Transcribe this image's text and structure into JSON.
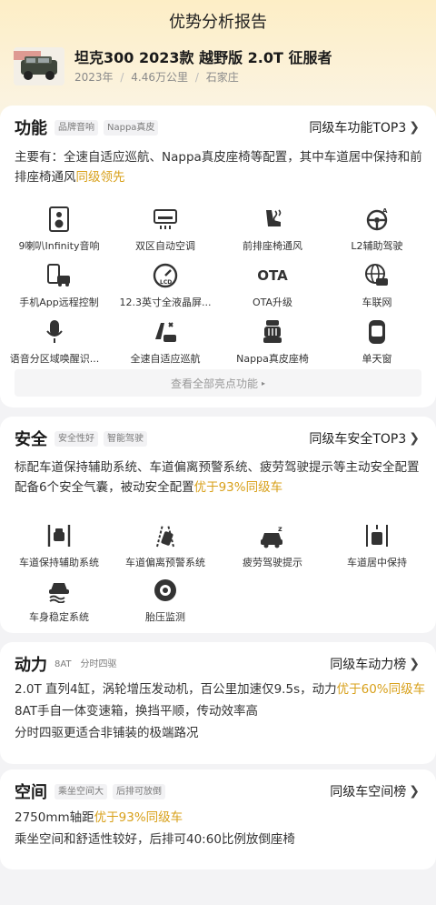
{
  "page_title": "优势分析报告",
  "car": {
    "name": "坦克300 2023款 越野版 2.0T 征服者",
    "year": "2023年",
    "mileage": "4.46万公里",
    "city": "石家庄",
    "sep": "/"
  },
  "function": {
    "title": "功能",
    "tags": [
      "品牌音响",
      "Nappa真皮"
    ],
    "rank": "同级车功能TOP3",
    "summary_prefix": "主要有：全速自适应巡航、Nappa真皮座椅等配置，其中车道居中保持和前排座椅通风",
    "summary_hl": "同级领先",
    "items": [
      {
        "label": "9喇叭Infinity音响",
        "icon": "speaker-icon"
      },
      {
        "label": "双区自动空调",
        "icon": "air-conditioner-icon"
      },
      {
        "label": "前排座椅通风",
        "icon": "seat-ventilation-icon"
      },
      {
        "label": "L2辅助驾驶",
        "icon": "steering-wheel-icon"
      },
      {
        "label": "手机App远程控制",
        "icon": "phone-car-icon"
      },
      {
        "label": "12.3英寸全液晶屏...",
        "icon": "lcd-gauge-icon"
      },
      {
        "label": "OTA升级",
        "icon": "ota-icon"
      },
      {
        "label": "车联网",
        "icon": "globe-car-icon"
      },
      {
        "label": "语音分区域唤醒识...",
        "icon": "microphone-icon"
      },
      {
        "label": "全速自适应巡航",
        "icon": "cruise-icon"
      },
      {
        "label": "Nappa真皮座椅",
        "icon": "leather-seat-icon"
      },
      {
        "label": "单天窗",
        "icon": "sunroof-icon"
      }
    ],
    "ota_text": "OTA",
    "more": "查看全部亮点功能",
    "more_arrow": "▸"
  },
  "safety": {
    "title": "安全",
    "tags": [
      "安全性好",
      "智能驾驶"
    ],
    "rank": "同级车安全TOP3",
    "summary_prefix": "标配车道保持辅助系统、车道偏离预警系统、疲劳驾驶提示等主动安全配置配备6个安全气囊，被动安全配置",
    "summary_hl": "优于93%同级车",
    "items": [
      {
        "label": "车道保持辅助系统",
        "icon": "lane-keep-icon"
      },
      {
        "label": "车道偏离预警系统",
        "icon": "lane-departure-icon"
      },
      {
        "label": "疲劳驾驶提示",
        "icon": "fatigue-icon"
      },
      {
        "label": "车道居中保持",
        "icon": "lane-center-icon"
      },
      {
        "label": "车身稳定系统",
        "icon": "stability-icon"
      },
      {
        "label": "胎压监测",
        "icon": "tire-pressure-icon"
      }
    ]
  },
  "power": {
    "title": "动力",
    "tags": [
      "8AT",
      "分时四驱"
    ],
    "rank": "同级车动力榜",
    "line1_prefix": "2.0T 直列4缸，涡轮增压发动机，百公里加速仅9.5s，动力",
    "line1_hl": "优于60%同级车",
    "line2": "8AT手自一体变速箱，换挡平顺，传动效率高",
    "line3": "分时四驱更适合非铺装的极端路况"
  },
  "space": {
    "title": "空间",
    "tags": [
      "乘坐空间大",
      "后排可放倒"
    ],
    "rank": "同级车空间榜",
    "line1_prefix": "2750mm轴距",
    "line1_hl": "优于93%同级车",
    "line2": "乘坐空间和舒适性较好，后排可40:60比例放倒座椅"
  },
  "chevron": "❯",
  "colors": {
    "accent": "#d8a01a",
    "header_gradient_top": "#fdeec6",
    "page_bg": "#f3f3f5"
  }
}
